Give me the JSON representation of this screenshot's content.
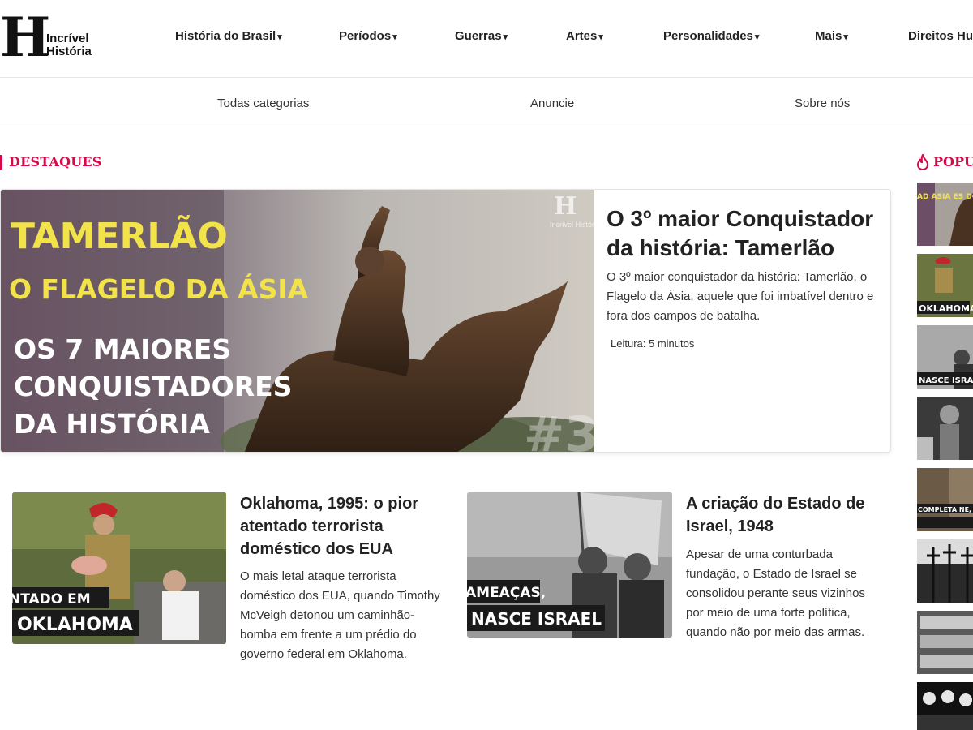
{
  "logo": {
    "letter": "H",
    "line1": "Incrível",
    "line2": "História"
  },
  "nav": [
    {
      "label": "História do Brasil",
      "caret": "▾"
    },
    {
      "label": "Períodos",
      "caret": "▾"
    },
    {
      "label": "Guerras",
      "caret": "▾"
    },
    {
      "label": "Artes",
      "caret": "▾"
    },
    {
      "label": "Personalidades",
      "caret": "▾"
    },
    {
      "label": "Mais",
      "caret": "▾"
    },
    {
      "label": "Direitos Hu",
      "caret": ""
    }
  ],
  "subnav": [
    "Todas categorias",
    "Anuncie",
    "Sobre nós"
  ],
  "destaques": {
    "heading": "DESTAQUES",
    "featured": {
      "title": "O 3º maior Conquistador da história: Tamerlão",
      "excerpt": "O 3º maior conquistador da história: Tamerlão, o Flagelo da Ásia, aquele que foi imbatível dentro e fora dos campos de batalha.",
      "reading_time": "Leitura: 5 minutos",
      "image_text": {
        "line1": "TAMERLÃO",
        "line2": "O FLAGELO DA ÁSIA",
        "line3": "OS 7 MAIORES",
        "line4": "CONQUISTADORES",
        "line5": "DA HISTÓRIA",
        "number": "#3",
        "watermark_letter": "H",
        "watermark_text": "Incrível História"
      }
    },
    "cards": [
      {
        "title": "Oklahoma, 1995: o pior atentado terrorista doméstico dos EUA",
        "excerpt": "O mais letal ataque terrorista doméstico dos EUA, quando Timothy McVeigh detonou um caminhão-bomba em frente a um prédio do governo federal em Oklahoma.",
        "image_caption_1": "NTADO EM",
        "image_caption_2": "OKLAHOMA"
      },
      {
        "title": "A criação do Estado de Israel, 1948",
        "excerpt": "Apesar de uma conturbada fundação, o Estado de Israel se consolidou perante seus vizinhos por meio de uma forte política, quando não por meio das armas.",
        "image_caption_1": "AMEAÇAS,",
        "image_caption_2": "NASCE ISRAEL"
      }
    ]
  },
  "popular": {
    "heading": "POPU",
    "thumbs": [
      {
        "caption": "AD ASIA ES DORES"
      },
      {
        "caption": "OKLAHOMA"
      },
      {
        "caption": "NASCE ISRAEL"
      },
      {
        "caption": ""
      },
      {
        "caption": "COMPLETA NE, O PODEROSO CHEF"
      },
      {
        "caption": ""
      },
      {
        "caption": ""
      },
      {
        "caption": ""
      }
    ]
  },
  "colors": {
    "accent": "#d6094a",
    "text": "#222222",
    "border": "#e6e6e6",
    "caption_bg": "#1a1a1a"
  }
}
